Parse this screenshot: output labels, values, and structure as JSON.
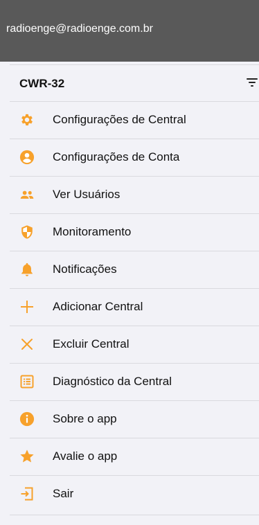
{
  "header": {
    "email": "radioenge@radioenge.com.br"
  },
  "central": {
    "name": "CWR-32"
  },
  "colors": {
    "accent": "#f7a12b",
    "header_bg": "#595959"
  },
  "menu": {
    "items": [
      {
        "label": "Configurações de Central",
        "icon": "gear-icon"
      },
      {
        "label": "Configurações de Conta",
        "icon": "account-icon"
      },
      {
        "label": "Ver Usuários",
        "icon": "users-icon"
      },
      {
        "label": "Monitoramento",
        "icon": "shield-icon"
      },
      {
        "label": "Notificações",
        "icon": "bell-icon"
      },
      {
        "label": "Adicionar Central",
        "icon": "plus-icon"
      },
      {
        "label": "Excluir Central",
        "icon": "close-icon"
      },
      {
        "label": "Diagnóstico da Central",
        "icon": "list-icon"
      },
      {
        "label": "Sobre o app",
        "icon": "info-icon"
      },
      {
        "label": "Avalie o app",
        "icon": "star-icon"
      },
      {
        "label": "Sair",
        "icon": "logout-icon"
      }
    ]
  }
}
